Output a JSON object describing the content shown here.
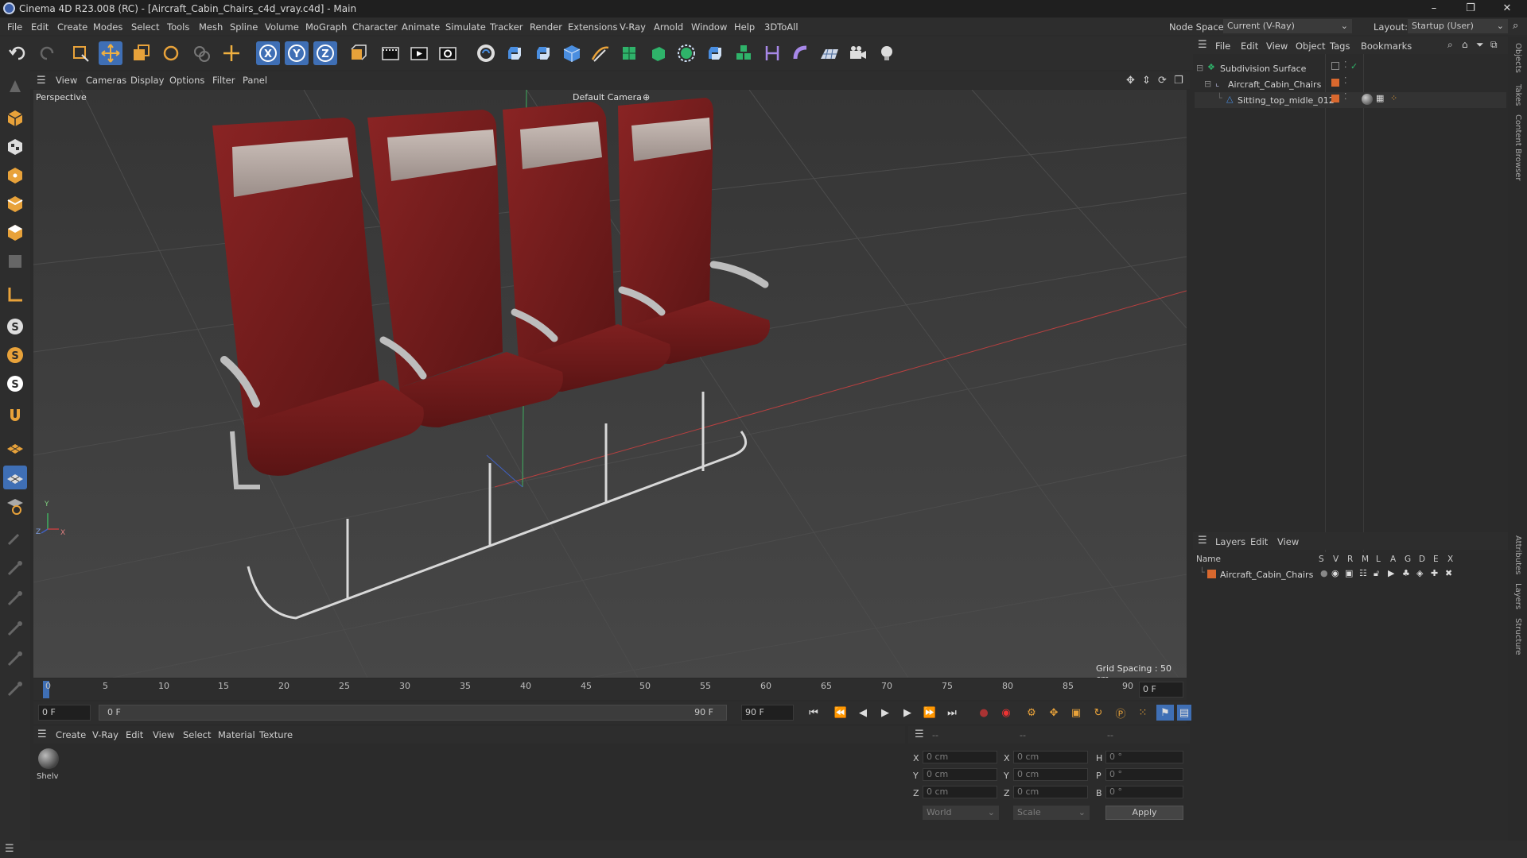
{
  "window": {
    "title": "Cinema 4D R23.008 (RC) - [Aircraft_Cabin_Chairs_c4d_vray.c4d] - Main",
    "controls": [
      "–",
      "❐",
      "✕"
    ]
  },
  "menubar": {
    "items": [
      "File",
      "Edit",
      "Create",
      "Modes",
      "Select",
      "Tools",
      "Mesh",
      "Spline",
      "Volume",
      "MoGraph",
      "Character",
      "Animate",
      "Simulate",
      "Tracker",
      "Render",
      "Extensions",
      "V-Ray",
      "Arnold",
      "Window",
      "Help",
      "3DToAll"
    ],
    "node_space_label": "Node Space:",
    "node_space_value": "Current (V-Ray)",
    "layout_label": "Layout:",
    "layout_value": "Startup (User)"
  },
  "viewport": {
    "menu": [
      "View",
      "Cameras",
      "Display",
      "Options",
      "Filter",
      "Panel"
    ],
    "view_name": "Perspective",
    "camera_label": "Default Camera",
    "grid_spacing": "Grid Spacing : 50 cm",
    "axis_labels": [
      "Y",
      "Z",
      "X"
    ]
  },
  "objects_panel": {
    "menu": [
      "File",
      "Edit",
      "View",
      "Object",
      "Tags",
      "Bookmarks"
    ],
    "tree": [
      {
        "name": "Subdivision Surface"
      },
      {
        "name": "Aircraft_Cabin_Chairs"
      },
      {
        "name": "Sitting_top_midle_012"
      }
    ]
  },
  "layers_panel": {
    "menu": [
      "Layers",
      "Edit",
      "View"
    ],
    "columns": [
      "Name",
      "S",
      "V",
      "R",
      "M",
      "L",
      "A",
      "G",
      "D",
      "E",
      "X"
    ],
    "rows": [
      {
        "name": "Aircraft_Cabin_Chairs",
        "color": "#d9682e"
      }
    ]
  },
  "side_tabs": [
    "Objects",
    "Takes",
    "Content Browser",
    "Attributes",
    "Layers",
    "Structure"
  ],
  "timeline": {
    "ticks": [
      "0",
      "5",
      "10",
      "15",
      "20",
      "25",
      "30",
      "35",
      "40",
      "45",
      "50",
      "55",
      "60",
      "65",
      "70",
      "75",
      "80",
      "85",
      "90"
    ],
    "current_frame": "0 F",
    "start": "0 F",
    "range_start": "0 F",
    "range_end": "90 F",
    "end": "90 F"
  },
  "material_manager": {
    "menu": [
      "Create",
      "V-Ray",
      "Edit",
      "View",
      "Select",
      "Material",
      "Texture"
    ],
    "materials": [
      {
        "name": "Shelv"
      }
    ]
  },
  "coordinates": {
    "headers": [
      "--",
      "--",
      "--"
    ],
    "rows": [
      {
        "a_label": "X",
        "a_value": "0 cm",
        "b_label": "X",
        "b_value": "0 cm",
        "c_label": "H",
        "c_value": "0 °"
      },
      {
        "a_label": "Y",
        "a_value": "0 cm",
        "b_label": "Y",
        "b_value": "0 cm",
        "c_label": "P",
        "c_value": "0 °"
      },
      {
        "a_label": "Z",
        "a_value": "0 cm",
        "b_label": "Z",
        "b_value": "0 cm",
        "c_label": "B",
        "c_value": "0 °"
      }
    ],
    "space": "World",
    "mode": "Scale",
    "apply": "Apply"
  },
  "colors": {
    "accent_blue": "#4a8ee0",
    "seat_red": "#7a1e1e",
    "layer_orange": "#d9682e"
  }
}
